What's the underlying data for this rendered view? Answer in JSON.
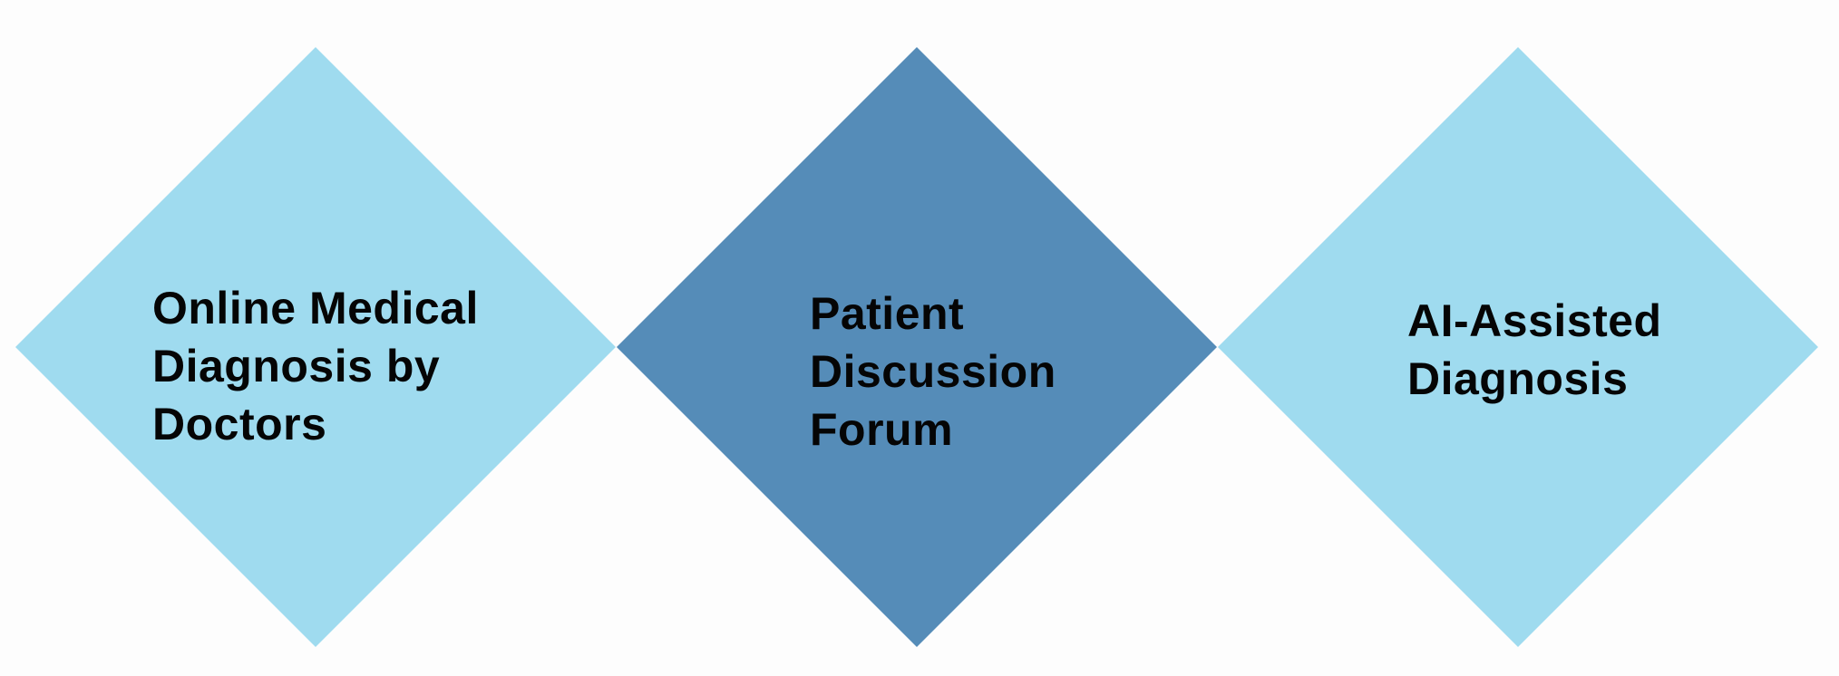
{
  "colors": {
    "background": "#fdfdfd",
    "light_diamond": "#9fdbef",
    "dark_diamond": "#558cb8",
    "text": "#050505"
  },
  "diamonds": [
    {
      "color": "#9fdbef",
      "lines": [
        "Online Medical",
        "Diagnosis by",
        "Doctors"
      ]
    },
    {
      "color": "#558cb8",
      "lines": [
        "Patient",
        "Discussion",
        "Forum"
      ]
    },
    {
      "color": "#9fdbef",
      "lines": [
        "AI-Assisted",
        "Diagnosis"
      ]
    }
  ]
}
